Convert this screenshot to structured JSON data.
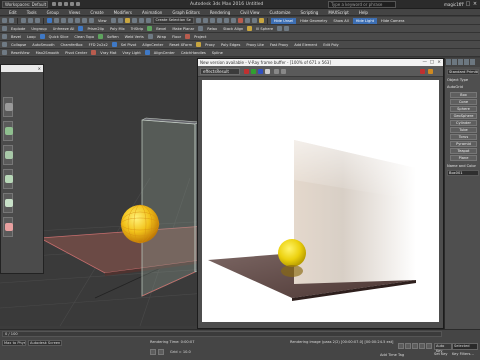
{
  "titlebar": {
    "workspace": "Workspaces: Default",
    "title": "Autodesk 3ds Max 2016    Untitled",
    "search_placeholder": "Type a keyword or phrase",
    "user": "magic167",
    "minimize": "—",
    "maximize": "□",
    "close": "×"
  },
  "menu": [
    "Edit",
    "Tools",
    "Group",
    "Views",
    "Create",
    "Modifiers",
    "Animation",
    "Graph Editors",
    "Rendering",
    "Civil View",
    "Customize",
    "Scripting",
    "MAXScript",
    "Help"
  ],
  "toolbar1": {
    "view_label": "View",
    "view_dropdown": "Create Selection Se",
    "right_buttons": [
      "Hide Unsel",
      "Hide Geometry",
      "Show All",
      "Hide Light",
      "Hide Camera",
      "Hide Helpers"
    ]
  },
  "toolbar2": {
    "labels": [
      "Explode",
      "Ungroup",
      "Unfreeze All",
      "Prism2lip",
      "Poly Mix",
      "TriStrip",
      "Bevel",
      "Make Planar",
      "Relax",
      "Stack Align",
      "Ill Sphere"
    ]
  },
  "toolbar3": {
    "labels": [
      "Bevel",
      "Loop",
      "Quick Slice",
      "Clean Topo",
      "Soften",
      "Weld Verts",
      "Wrap",
      "Floor",
      "Project"
    ]
  },
  "toolbar4": {
    "labels": [
      "Collapse",
      "AutoSmooth",
      "ChamferBox",
      "FFD 2x2x2",
      "Sel Pivot",
      "AlignCenter",
      "Reset XForm",
      "Proxy",
      "Poly Edges",
      "Proxy Lite",
      "Fast Proxy",
      "Add Element",
      "Edit Poly"
    ]
  },
  "toolbar5": {
    "labels": [
      "ResetView",
      "Max2Smooth",
      "Pivot Center",
      "Vray Mat",
      "Vray Light",
      "AlignCenter",
      "CatchHandles",
      "Spline"
    ]
  },
  "viewport": {
    "label": "[+] [Perspective] [Standard] [Default Shading]"
  },
  "material_editor": {
    "title": "",
    "close": "×"
  },
  "vfb": {
    "title": "New version available - V-Ray frame buffer - [100% of 671 x 563]",
    "channel": "effectsResult"
  },
  "command_panel": {
    "dropdown": "Standard Primitives",
    "section": "Object Type",
    "autogrid": "AutoGrid",
    "buttons": [
      "Box",
      "Cone",
      "Sphere",
      "GeoSphere",
      "Cylinder",
      "Tube",
      "Torus",
      "Pyramid",
      "Teapot",
      "Plane"
    ],
    "name_section": "Name and Color",
    "name_value": "Box001"
  },
  "status": {
    "frame": "0 / 100",
    "max_to_physc": "Max to Physc.",
    "mode": "Autodesk Screen Deferred",
    "render_time": "Rendering Time: 0:00:07",
    "prompt": "Rendering image (pass 2/2) [00:00:07.0] [00:00:24.5 est]",
    "autokey": "Auto Key",
    "selected": "Selected",
    "setkey": "Set Key",
    "key_filters": "Key Filters...",
    "add_time_tag": "Add Time Tag",
    "grid": "Grid = 10.0"
  }
}
